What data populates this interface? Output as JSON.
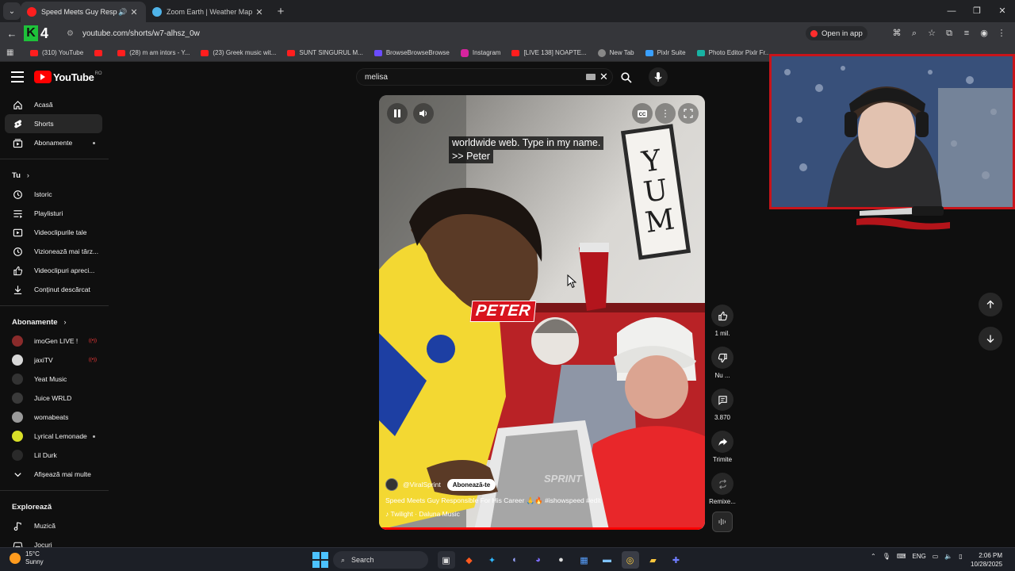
{
  "browser": {
    "tabs": [
      {
        "title": "Speed Meets Guy Responsibl",
        "active": true
      },
      {
        "title": "Zoom Earth | Weather Map & H",
        "active": false
      }
    ],
    "url": "youtube.com/shorts/w7-alhsz_0w",
    "open_in_app": "Open in app",
    "bookmarks": [
      "(310) YouTube",
      "(28) m am intors - Y...",
      "(23) Greek music wit...",
      "SUNT SINGURUL M...",
      "BrowseBrowseBrowse",
      "Instagram",
      "[LIVE 138] NOAPTE...",
      "New Tab",
      "Pixlr Suite",
      "Photo Editor Pixlr Fr..."
    ]
  },
  "youtube": {
    "logo_text": "YouTube",
    "logo_country": "RO",
    "search_value": "melisa"
  },
  "sidebar": {
    "main": [
      {
        "label": "Acasă",
        "icon": "home-icon"
      },
      {
        "label": "Shorts",
        "icon": "shorts-icon"
      },
      {
        "label": "Abonamente",
        "icon": "subscriptions-icon"
      }
    ],
    "you_heading": "Tu",
    "you": [
      {
        "label": "Istoric",
        "icon": "history-icon"
      },
      {
        "label": "Playlisturi",
        "icon": "playlists-icon"
      },
      {
        "label": "Videoclipurile tale",
        "icon": "your-videos-icon"
      },
      {
        "label": "Vizionează mai târz...",
        "icon": "watch-later-icon"
      },
      {
        "label": "Videoclipuri apreci...",
        "icon": "liked-icon"
      },
      {
        "label": "Conținut descărcat",
        "icon": "download-icon"
      }
    ],
    "subs_heading": "Abonamente",
    "subs": [
      {
        "label": "imoGen LIVE !",
        "live": true,
        "color": "#8a2b2b"
      },
      {
        "label": "jaxiTV",
        "live": true,
        "color": "#d8d8d8"
      },
      {
        "label": "Yeat Music",
        "live": false,
        "color": "#333333"
      },
      {
        "label": "Juice WRLD",
        "live": false,
        "color": "#3a3a3a"
      },
      {
        "label": "womabeats",
        "live": false,
        "color": "#9a9a9a"
      },
      {
        "label": "Lyrical Lemonade",
        "live": false,
        "dot": true,
        "color": "#d9e028"
      },
      {
        "label": "Lil Durk",
        "live": false,
        "color": "#2a2a2a"
      }
    ],
    "show_more": "Afișează mai multe",
    "explore_heading": "Explorează",
    "explore": [
      {
        "label": "Muzică",
        "icon": "music-icon"
      },
      {
        "label": "Jocuri",
        "icon": "gaming-icon"
      }
    ]
  },
  "short": {
    "caption_line1": "worldwide web. Type in my name.",
    "caption_line2": ">> Peter",
    "name_overlay": "PETER",
    "sign_text": [
      "Y",
      "U",
      "M"
    ],
    "watermark": "SPRINT",
    "channel": "@ViralSprint",
    "subscribe": "Abonează-te",
    "title": "Speed Meets Guy Responsible For His Career 🙏🔥 #ishowspeed #edit",
    "music": "Twilight · Daluna Music",
    "progress": 0.99
  },
  "actions": {
    "like": "1 mil.",
    "dislike": "Nu ...",
    "comments": "3.870",
    "share": "Trimite",
    "remix": "Remixe..."
  },
  "taskbar": {
    "temp": "15°C",
    "weather": "Sunny",
    "search": "Search",
    "lang": "ENG",
    "time": "2:06 PM",
    "date": "10/28/2025"
  }
}
